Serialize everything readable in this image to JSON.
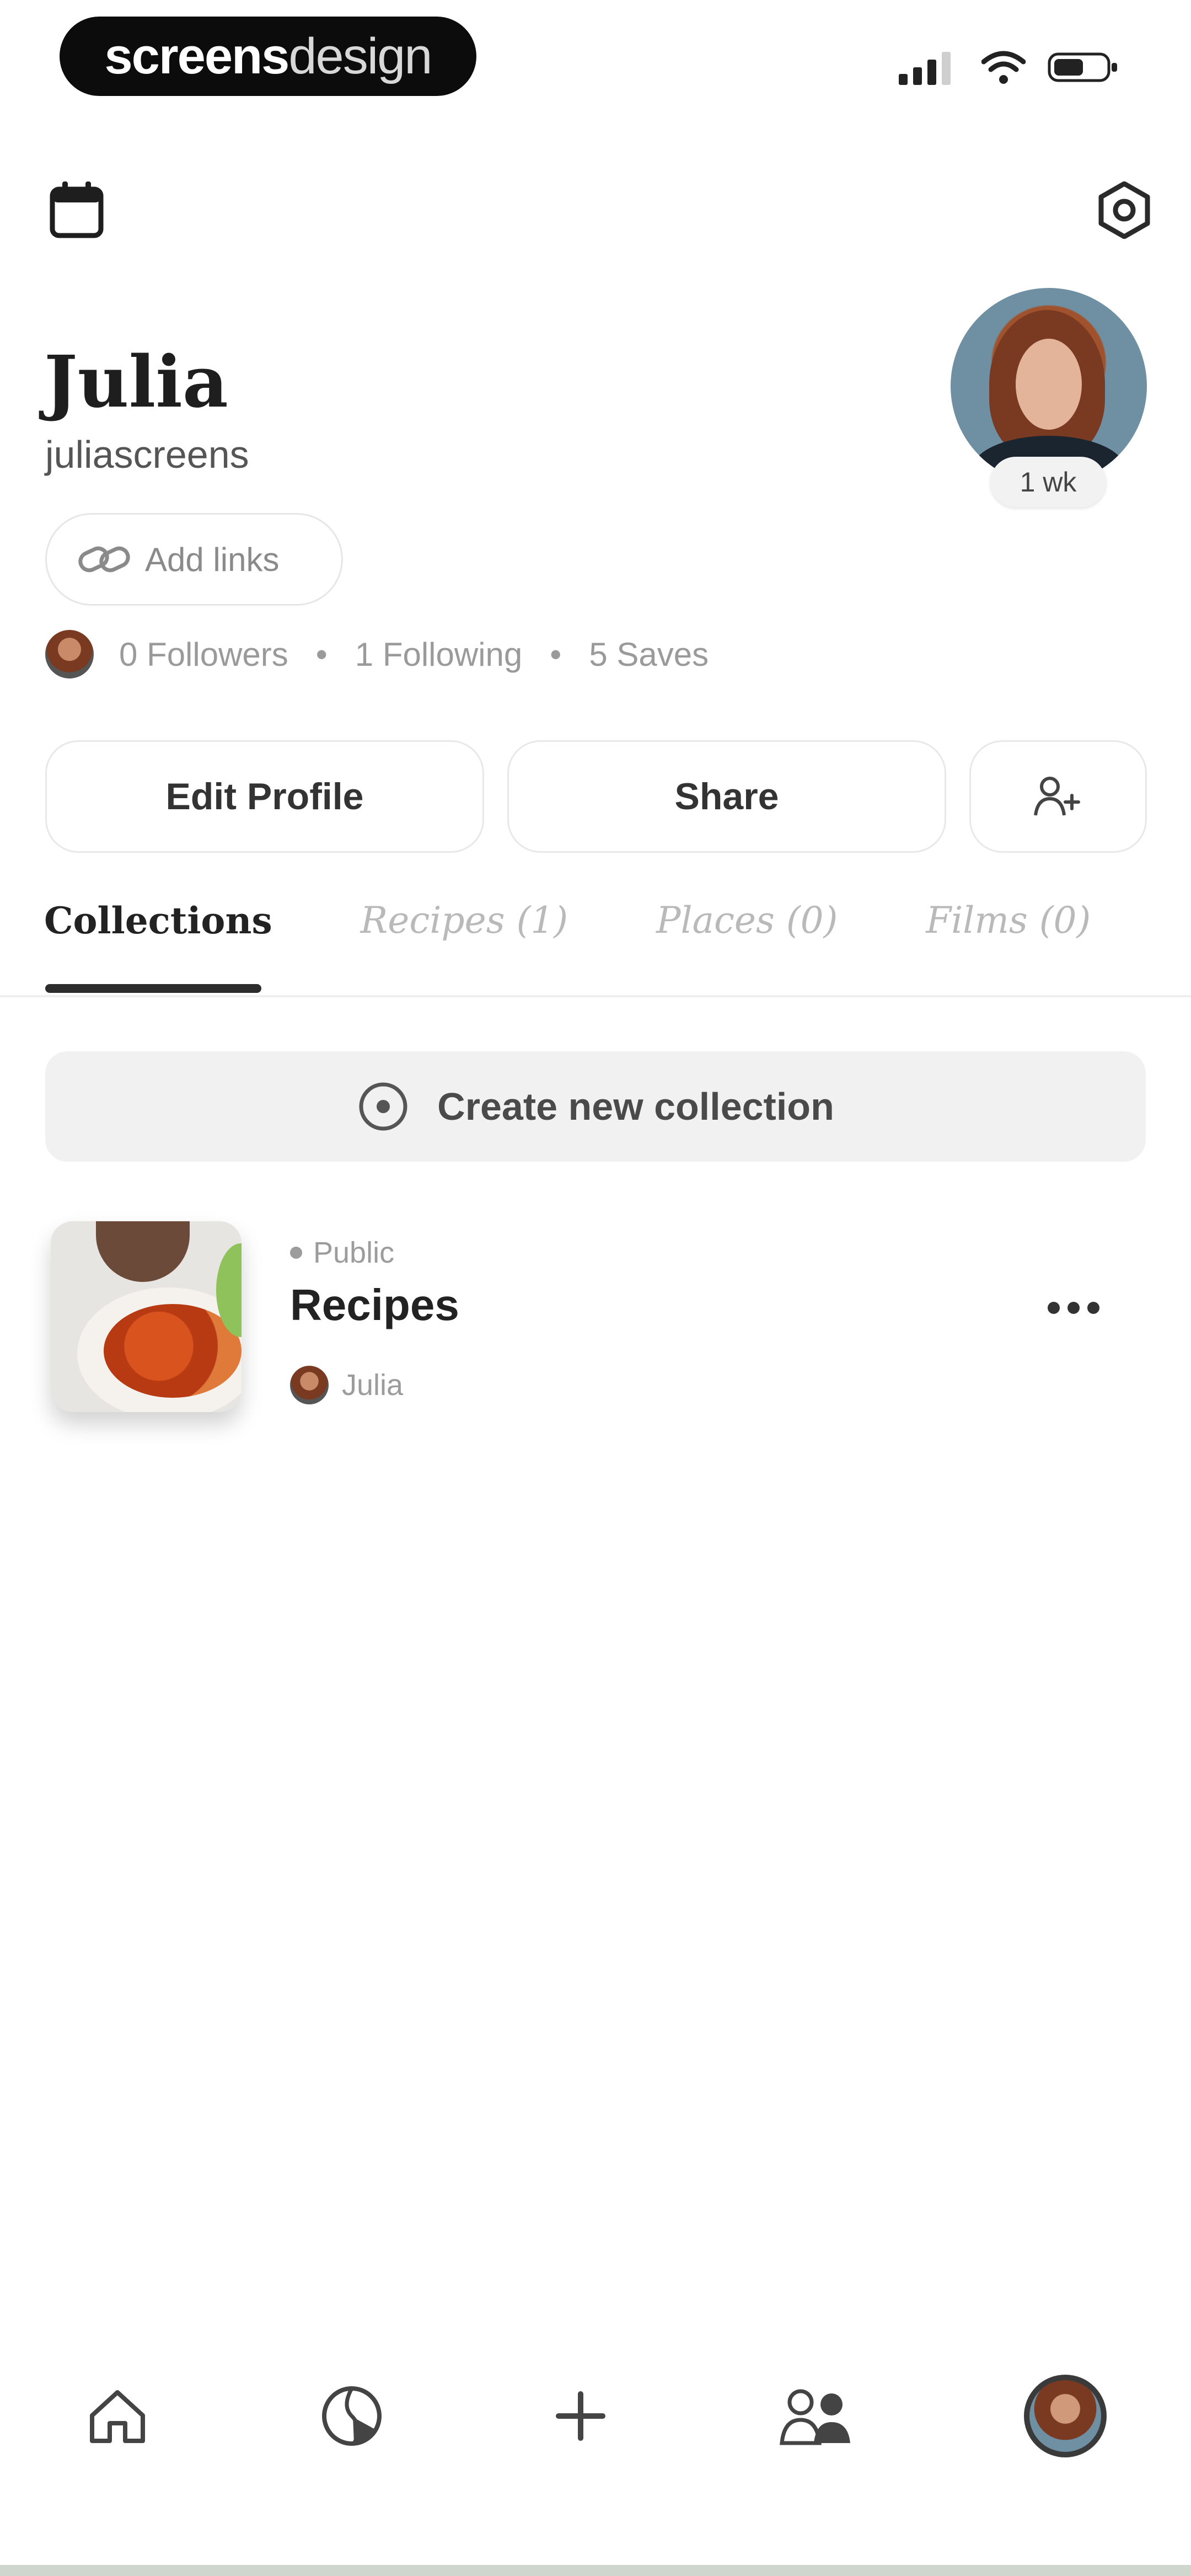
{
  "status_bar": {
    "brand_bold": "screens",
    "brand_light": "design",
    "icons": [
      "signal-icon",
      "wifi-icon",
      "battery-icon"
    ]
  },
  "header": {
    "calendar_icon": "calendar-icon",
    "settings_icon": "gear-icon"
  },
  "profile": {
    "name": "Julia",
    "handle": "juliascreens",
    "avatar_badge": "1 wk",
    "add_links_label": "Add links",
    "followers": "0 Followers",
    "following": "1 Following",
    "saves": "5 Saves",
    "separator": "•"
  },
  "actions": {
    "edit_profile": "Edit Profile",
    "share": "Share",
    "add_friend_icon": "add-user-icon"
  },
  "tabs": [
    {
      "label": "Collections",
      "active": true
    },
    {
      "label": "Recipes (1)",
      "active": false
    },
    {
      "label": "Places (0)",
      "active": false
    },
    {
      "label": "Films (0)",
      "active": false
    }
  ],
  "create_collection": {
    "label": "Create new collection",
    "icon": "plus-circle-icon"
  },
  "collections": [
    {
      "visibility": "Public",
      "title": "Recipes",
      "owner": "Julia"
    }
  ],
  "bottom_nav": [
    {
      "name": "home",
      "icon": "home-icon"
    },
    {
      "name": "explore",
      "icon": "globe-icon"
    },
    {
      "name": "create",
      "icon": "plus-icon"
    },
    {
      "name": "friends",
      "icon": "people-icon"
    },
    {
      "name": "profile",
      "icon": "avatar"
    }
  ],
  "colors": {
    "text_primary": "#222222",
    "text_muted": "#9a9a9a",
    "pill_bg": "#0c0c0c",
    "button_border": "#e8e8e8",
    "create_bg": "#f1f1f1"
  }
}
